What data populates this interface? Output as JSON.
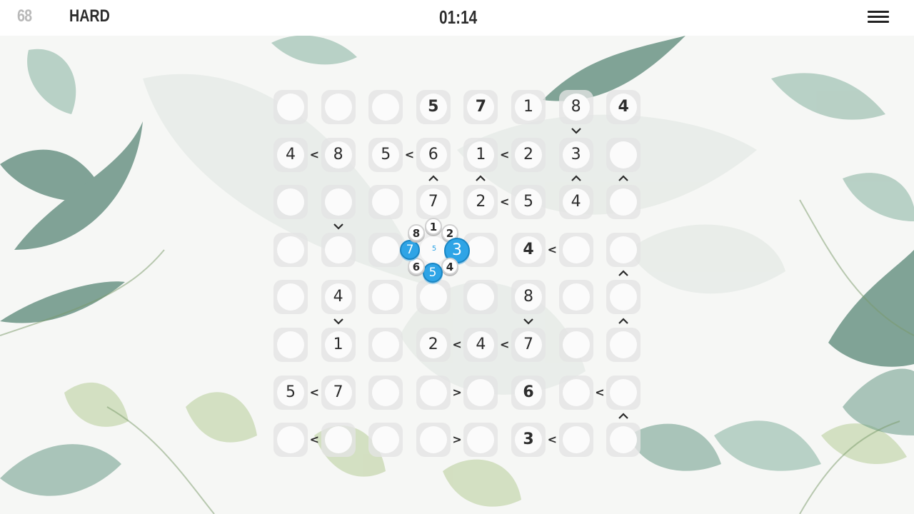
{
  "header": {
    "level": "68",
    "difficulty": "HARD",
    "timer": "01:14"
  },
  "colors": {
    "accent": "#2ea4e6",
    "text": "#2c2c2c",
    "muted": "#b9b9b9",
    "cell_bg": "#e4e4e4"
  },
  "board": {
    "size": 8,
    "cells": [
      [
        {
          "v": "",
          "g": false
        },
        {
          "v": "",
          "g": false
        },
        {
          "v": "",
          "g": false
        },
        {
          "v": "5",
          "g": true
        },
        {
          "v": "7",
          "g": true
        },
        {
          "v": "1",
          "g": false
        },
        {
          "v": "8",
          "g": false
        },
        {
          "v": "4",
          "g": true
        }
      ],
      [
        {
          "v": "4",
          "g": false
        },
        {
          "v": "8",
          "g": false
        },
        {
          "v": "5",
          "g": false
        },
        {
          "v": "6",
          "g": false
        },
        {
          "v": "1",
          "g": false
        },
        {
          "v": "2",
          "g": false
        },
        {
          "v": "3",
          "g": false
        },
        {
          "v": "",
          "g": false
        }
      ],
      [
        {
          "v": "",
          "g": false
        },
        {
          "v": "",
          "g": false
        },
        {
          "v": "",
          "g": false
        },
        {
          "v": "7",
          "g": false
        },
        {
          "v": "2",
          "g": false
        },
        {
          "v": "5",
          "g": false
        },
        {
          "v": "4",
          "g": false
        },
        {
          "v": "",
          "g": false
        }
      ],
      [
        {
          "v": "",
          "g": false
        },
        {
          "v": "",
          "g": false
        },
        {
          "v": "",
          "g": false
        },
        {
          "v": "",
          "g": false
        },
        {
          "v": "",
          "g": false
        },
        {
          "v": "4",
          "g": true
        },
        {
          "v": "",
          "g": false
        },
        {
          "v": "",
          "g": false
        }
      ],
      [
        {
          "v": "",
          "g": false
        },
        {
          "v": "4",
          "g": false
        },
        {
          "v": "",
          "g": false
        },
        {
          "v": "",
          "g": false
        },
        {
          "v": "",
          "g": false
        },
        {
          "v": "8",
          "g": false
        },
        {
          "v": "",
          "g": false
        },
        {
          "v": "",
          "g": false
        }
      ],
      [
        {
          "v": "",
          "g": false
        },
        {
          "v": "1",
          "g": false
        },
        {
          "v": "",
          "g": false
        },
        {
          "v": "2",
          "g": false
        },
        {
          "v": "4",
          "g": false
        },
        {
          "v": "7",
          "g": false
        },
        {
          "v": "",
          "g": false
        },
        {
          "v": "",
          "g": false
        }
      ],
      [
        {
          "v": "5",
          "g": false
        },
        {
          "v": "7",
          "g": false
        },
        {
          "v": "",
          "g": false
        },
        {
          "v": "",
          "g": false
        },
        {
          "v": "",
          "g": false
        },
        {
          "v": "6",
          "g": true
        },
        {
          "v": "",
          "g": false
        },
        {
          "v": "",
          "g": false
        }
      ],
      [
        {
          "v": "",
          "g": false
        },
        {
          "v": "",
          "g": false
        },
        {
          "v": "",
          "g": false
        },
        {
          "v": "",
          "g": false
        },
        {
          "v": "",
          "g": false
        },
        {
          "v": "3",
          "g": true
        },
        {
          "v": "",
          "g": false
        },
        {
          "v": "",
          "g": false
        }
      ]
    ],
    "selected": {
      "row": 3,
      "col": 3
    },
    "h_constraints": [
      {
        "row": 1,
        "col": 0,
        "sym": "<"
      },
      {
        "row": 1,
        "col": 2,
        "sym": "<"
      },
      {
        "row": 1,
        "col": 4,
        "sym": "<"
      },
      {
        "row": 2,
        "col": 4,
        "sym": "<"
      },
      {
        "row": 3,
        "col": 5,
        "sym": "<"
      },
      {
        "row": 5,
        "col": 3,
        "sym": "<"
      },
      {
        "row": 5,
        "col": 4,
        "sym": "<"
      },
      {
        "row": 6,
        "col": 0,
        "sym": "<"
      },
      {
        "row": 6,
        "col": 3,
        "sym": ">"
      },
      {
        "row": 6,
        "col": 6,
        "sym": "<"
      },
      {
        "row": 7,
        "col": 0,
        "sym": "<"
      },
      {
        "row": 7,
        "col": 3,
        "sym": ">"
      },
      {
        "row": 7,
        "col": 5,
        "sym": "<"
      }
    ],
    "v_constraints": [
      {
        "row": 0,
        "col": 6,
        "dir": "down"
      },
      {
        "row": 1,
        "col": 3,
        "dir": "up"
      },
      {
        "row": 1,
        "col": 4,
        "dir": "up"
      },
      {
        "row": 1,
        "col": 6,
        "dir": "up"
      },
      {
        "row": 1,
        "col": 7,
        "dir": "up"
      },
      {
        "row": 2,
        "col": 1,
        "dir": "down"
      },
      {
        "row": 3,
        "col": 7,
        "dir": "up"
      },
      {
        "row": 4,
        "col": 1,
        "dir": "down"
      },
      {
        "row": 4,
        "col": 5,
        "dir": "down"
      },
      {
        "row": 4,
        "col": 7,
        "dir": "up"
      },
      {
        "row": 6,
        "col": 7,
        "dir": "up"
      }
    ]
  },
  "picker": {
    "center_label": "5",
    "options": [
      {
        "num": "1",
        "state": "white"
      },
      {
        "num": "2",
        "state": "white"
      },
      {
        "num": "3",
        "state": "blue-large"
      },
      {
        "num": "4",
        "state": "white"
      },
      {
        "num": "5",
        "state": "blue"
      },
      {
        "num": "6",
        "state": "white"
      },
      {
        "num": "7",
        "state": "blue"
      },
      {
        "num": "8",
        "state": "white"
      }
    ]
  }
}
